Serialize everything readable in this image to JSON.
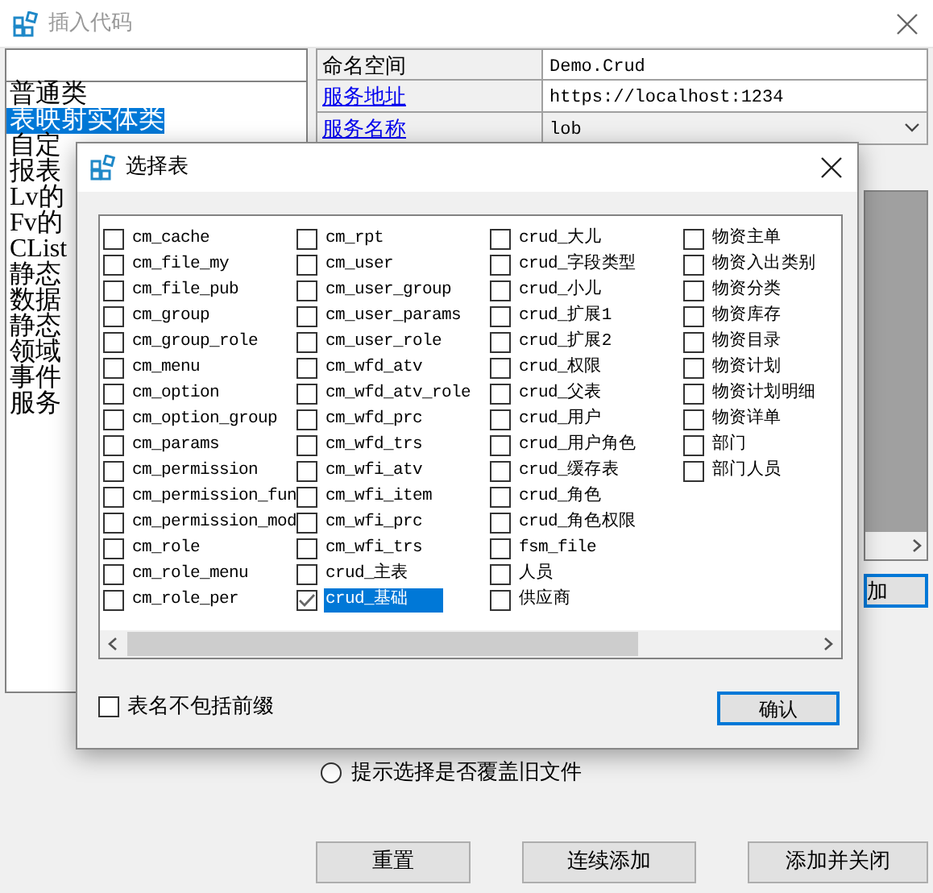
{
  "window": {
    "title": "插入代码"
  },
  "class_list": {
    "items": [
      {
        "label": "普通类",
        "selected": false
      },
      {
        "label": "表映射实体类",
        "selected": true
      },
      {
        "label": "自定",
        "selected": false
      },
      {
        "label": "报表",
        "selected": false
      },
      {
        "label": "Lv的",
        "selected": false
      },
      {
        "label": "Fv的",
        "selected": false
      },
      {
        "label": "CList",
        "selected": false
      },
      {
        "label": "静态",
        "selected": false
      },
      {
        "label": "数据",
        "selected": false
      },
      {
        "label": "静态",
        "selected": false
      },
      {
        "label": "领域",
        "selected": false
      },
      {
        "label": "事件",
        "selected": false
      },
      {
        "label": "服务",
        "selected": false
      }
    ]
  },
  "properties": [
    {
      "name": "命名空间",
      "kind": "plain",
      "value": "Demo.Crud"
    },
    {
      "name": "服务地址",
      "kind": "link",
      "value": "https://localhost:1234"
    },
    {
      "name": "服务名称",
      "kind": "link",
      "value": "lob",
      "dropdown": true
    }
  ],
  "side_panel": {
    "button": "加"
  },
  "overwrite_prompt": {
    "label": "提示选择是否覆盖旧文件",
    "selected": false
  },
  "buttons": [
    "重置",
    "连续添加",
    "添加并关闭"
  ],
  "dialog": {
    "title": "选择表",
    "tables": [
      {
        "label": "cm_cache",
        "checked": false,
        "selected": false
      },
      {
        "label": "cm_file_my",
        "checked": false,
        "selected": false
      },
      {
        "label": "cm_file_pub",
        "checked": false,
        "selected": false
      },
      {
        "label": "cm_group",
        "checked": false,
        "selected": false
      },
      {
        "label": "cm_group_role",
        "checked": false,
        "selected": false
      },
      {
        "label": "cm_menu",
        "checked": false,
        "selected": false
      },
      {
        "label": "cm_option",
        "checked": false,
        "selected": false
      },
      {
        "label": "cm_option_group",
        "checked": false,
        "selected": false
      },
      {
        "label": "cm_params",
        "checked": false,
        "selected": false
      },
      {
        "label": "cm_permission",
        "checked": false,
        "selected": false
      },
      {
        "label": "cm_permission_fun",
        "checked": false,
        "selected": false
      },
      {
        "label": "cm_permission_mod",
        "checked": false,
        "selected": false
      },
      {
        "label": "cm_role",
        "checked": false,
        "selected": false
      },
      {
        "label": "cm_role_menu",
        "checked": false,
        "selected": false
      },
      {
        "label": "cm_role_per",
        "checked": false,
        "selected": false
      },
      {
        "label": "cm_rpt",
        "checked": false,
        "selected": false
      },
      {
        "label": "cm_user",
        "checked": false,
        "selected": false
      },
      {
        "label": "cm_user_group",
        "checked": false,
        "selected": false
      },
      {
        "label": "cm_user_params",
        "checked": false,
        "selected": false
      },
      {
        "label": "cm_user_role",
        "checked": false,
        "selected": false
      },
      {
        "label": "cm_wfd_atv",
        "checked": false,
        "selected": false
      },
      {
        "label": "cm_wfd_atv_role",
        "checked": false,
        "selected": false
      },
      {
        "label": "cm_wfd_prc",
        "checked": false,
        "selected": false
      },
      {
        "label": "cm_wfd_trs",
        "checked": false,
        "selected": false
      },
      {
        "label": "cm_wfi_atv",
        "checked": false,
        "selected": false
      },
      {
        "label": "cm_wfi_item",
        "checked": false,
        "selected": false
      },
      {
        "label": "cm_wfi_prc",
        "checked": false,
        "selected": false
      },
      {
        "label": "cm_wfi_trs",
        "checked": false,
        "selected": false
      },
      {
        "label": "crud_主表",
        "checked": false,
        "selected": false
      },
      {
        "label": "crud_基础",
        "checked": true,
        "selected": true
      },
      {
        "label": "crud_大儿",
        "checked": false,
        "selected": false
      },
      {
        "label": "crud_字段类型",
        "checked": false,
        "selected": false
      },
      {
        "label": "crud_小儿",
        "checked": false,
        "selected": false
      },
      {
        "label": "crud_扩展1",
        "checked": false,
        "selected": false
      },
      {
        "label": "crud_扩展2",
        "checked": false,
        "selected": false
      },
      {
        "label": "crud_权限",
        "checked": false,
        "selected": false
      },
      {
        "label": "crud_父表",
        "checked": false,
        "selected": false
      },
      {
        "label": "crud_用户",
        "checked": false,
        "selected": false
      },
      {
        "label": "crud_用户角色",
        "checked": false,
        "selected": false
      },
      {
        "label": "crud_缓存表",
        "checked": false,
        "selected": false
      },
      {
        "label": "crud_角色",
        "checked": false,
        "selected": false
      },
      {
        "label": "crud_角色权限",
        "checked": false,
        "selected": false
      },
      {
        "label": "fsm_file",
        "checked": false,
        "selected": false
      },
      {
        "label": "人员",
        "checked": false,
        "selected": false
      },
      {
        "label": "供应商",
        "checked": false,
        "selected": false
      },
      {
        "label": "物资主单",
        "checked": false,
        "selected": false
      },
      {
        "label": "物资入出类别",
        "checked": false,
        "selected": false
      },
      {
        "label": "物资分类",
        "checked": false,
        "selected": false
      },
      {
        "label": "物资库存",
        "checked": false,
        "selected": false
      },
      {
        "label": "物资目录",
        "checked": false,
        "selected": false
      },
      {
        "label": "物资计划",
        "checked": false,
        "selected": false
      },
      {
        "label": "物资计划明细",
        "checked": false,
        "selected": false
      },
      {
        "label": "物资详单",
        "checked": false,
        "selected": false
      },
      {
        "label": "部门",
        "checked": false,
        "selected": false
      },
      {
        "label": "部门人员",
        "checked": false,
        "selected": false
      }
    ],
    "exclude_prefix": {
      "label": "表名不包括前缀",
      "checked": false
    },
    "ok_button": "确认"
  }
}
